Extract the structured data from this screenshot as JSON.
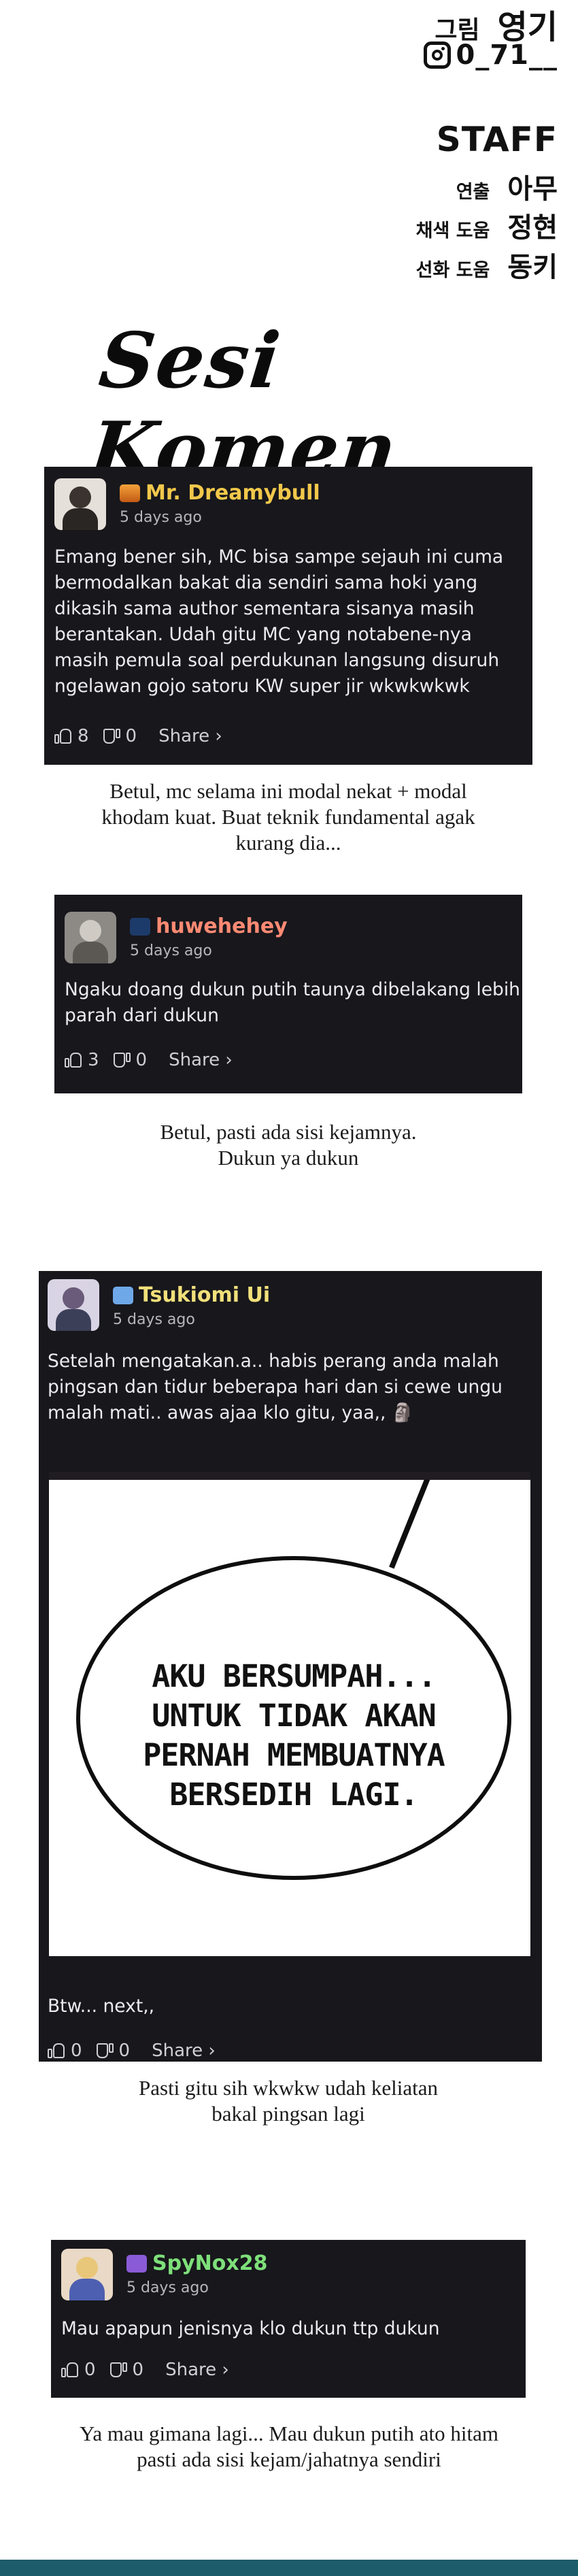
{
  "credits": {
    "art_label": "그림",
    "art_name": "영기",
    "instagram_handle": "0_71__",
    "staff_title": "STAFF",
    "direction_label": "연출",
    "direction_name": "아무",
    "color_label": "채색 도움",
    "color_name": "정현",
    "line_label": "선화 도움",
    "line_name": "동키"
  },
  "section_title": "Sesi Komen",
  "comments": [
    {
      "username": "Mr. Dreamybull",
      "username_color": "#f2c84b",
      "badge_icon": "fire-badge-icon",
      "time": "5 days ago",
      "text_lines": [
        "Emang bener sih, MC bisa sampe sejauh ini cuma",
        "bermodalkan bakat dia sendiri sama hoki yang",
        "dikasih sama author sementara sisanya masih",
        "berantakan. Udah gitu MC yang notabene-nya",
        "masih pemula soal perdukunan langsung disuruh",
        "ngelawan gojo satoru KW super jir wkwkwkwk"
      ],
      "likes": "8",
      "dislikes": "0",
      "share_label": "Share ›",
      "reply_lines": [
        "Betul, mc selama ini modal nekat + modal",
        "khodam kuat. Buat teknik fundamental agak",
        "kurang dia..."
      ]
    },
    {
      "username": "huwehehey",
      "username_color": "#ff8a73",
      "badge_icon": "blue-badge-icon",
      "time": "5 days ago",
      "text_lines": [
        "Ngaku doang dukun putih taunya dibelakang lebih",
        "parah dari dukun"
      ],
      "likes": "3",
      "dislikes": "0",
      "share_label": "Share ›",
      "reply_lines": [
        "Betul, pasti ada sisi kejamnya.",
        "Dukun ya dukun"
      ]
    },
    {
      "username": "Tsukiomi Ui",
      "username_color": "#f2e07a",
      "badge_icon": "wings-badge-icon",
      "time": "5 days ago",
      "text_lines": [
        "Setelah mengatakan.a.. habis perang anda malah",
        "pingsan dan tidur beberapa hari dan si cewe ungu",
        "malah mati.. awas ajaa klo gitu, yaa,, 🗿"
      ],
      "panel_lines": [
        "AKU BERSUMPAH...",
        "UNTUK TIDAK AKAN",
        "PERNAH MEMBUATNYA",
        "BERSEDIH LAGI."
      ],
      "footer_text": "Btw... next,,",
      "likes": "0",
      "dislikes": "0",
      "share_label": "Share ›",
      "reply_lines": [
        "Pasti gitu sih wkwkw udah keliatan",
        "bakal pingsan lagi"
      ]
    },
    {
      "username": "SpyNox28",
      "username_color": "#7ee07a",
      "badge_icon": "purple-badge-icon",
      "time": "5 days ago",
      "text_lines": [
        "Mau apapun jenisnya klo dukun ttp dukun"
      ],
      "likes": "0",
      "dislikes": "0",
      "share_label": "Share ›",
      "reply_lines": [
        "Ya mau gimana lagi... Mau dukun putih ato hitam",
        "pasti ada sisi kejam/jahatnya sendiri"
      ]
    }
  ]
}
